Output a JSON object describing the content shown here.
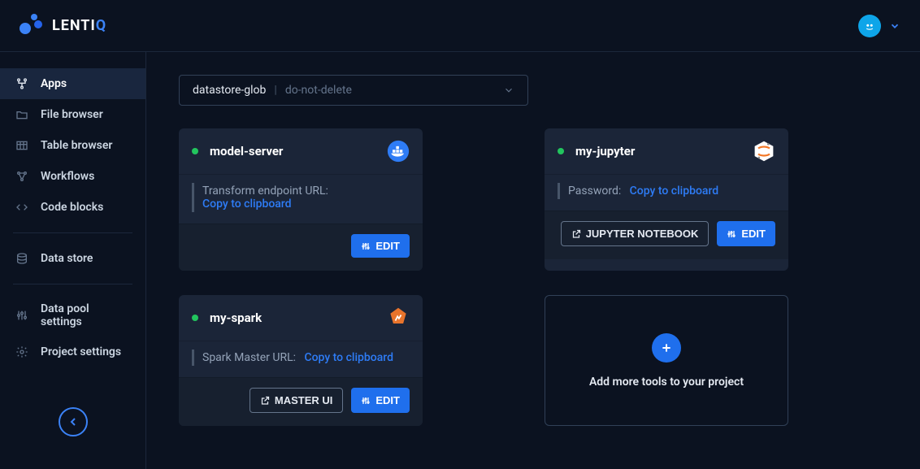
{
  "brand": "LENTIQ",
  "selector": {
    "p1": "datastore-glob",
    "p2": "do-not-delete"
  },
  "sidebar": {
    "items": [
      {
        "label": "Apps"
      },
      {
        "label": "File browser"
      },
      {
        "label": "Table browser"
      },
      {
        "label": "Workflows"
      },
      {
        "label": "Code blocks"
      }
    ],
    "items2": [
      {
        "label": "Data store"
      }
    ],
    "items3": [
      {
        "label": "Data pool settings"
      },
      {
        "label": "Project settings"
      }
    ]
  },
  "cards": {
    "model_server": {
      "title": "model-server",
      "info_label": "Transform endpoint URL:",
      "copy": "Copy to clipboard",
      "edit": "EDIT"
    },
    "jupyter": {
      "title": "my-jupyter",
      "info_label": "Password:",
      "copy": "Copy to clipboard",
      "open": "JUPYTER NOTEBOOK",
      "edit": "EDIT"
    },
    "spark": {
      "title": "my-spark",
      "info_label": "Spark Master URL:",
      "copy": "Copy to clipboard",
      "open": "MASTER UI",
      "edit": "EDIT"
    },
    "add": {
      "text": "Add more tools to your project"
    }
  }
}
